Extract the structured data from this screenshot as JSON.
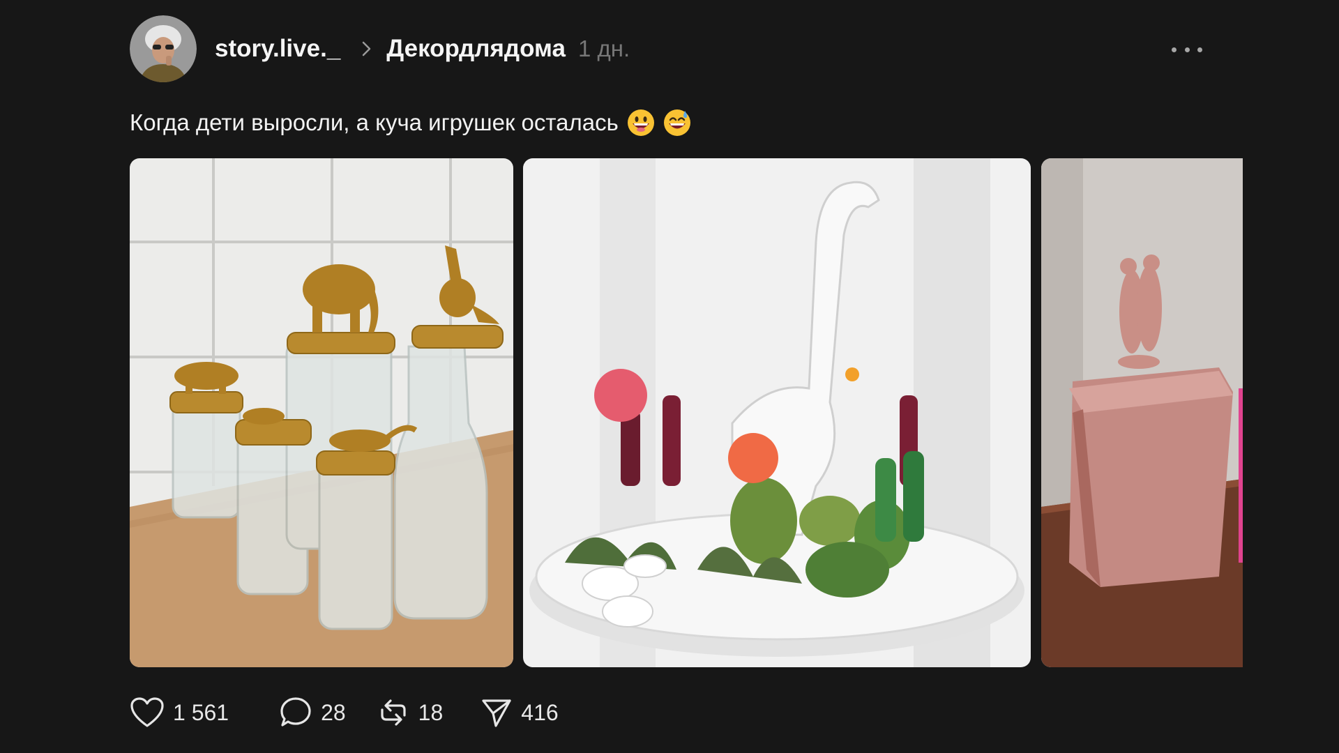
{
  "post": {
    "username": "story.live._",
    "community": "Декордлядома",
    "time": "1 дн.",
    "text": "Когда дети выросли, а куча игрушек осталась"
  },
  "icons": {
    "avatar": "avatar-photo",
    "chevron": "chevron-right-icon",
    "more": "more-dots-icon",
    "emoji_1": "grinning-face-emoji",
    "emoji_2": "grinning-sweat-emoji",
    "like": "heart-icon",
    "comment": "comment-bubble-icon",
    "repost": "repost-icon",
    "share": "send-icon"
  },
  "gallery": [
    {
      "subject": "gold-animal-jar-lids"
    },
    {
      "subject": "white-dinosaur-cactus-tray"
    },
    {
      "subject": "rose-gold-meerkat-tin"
    }
  ],
  "actions": {
    "likes": "1 561",
    "comments": "28",
    "reposts": "18",
    "shares": "416"
  },
  "colors": {
    "background": "#171717",
    "text": "#f3f3f3",
    "muted": "#777777",
    "gold": "#b98a2e"
  }
}
